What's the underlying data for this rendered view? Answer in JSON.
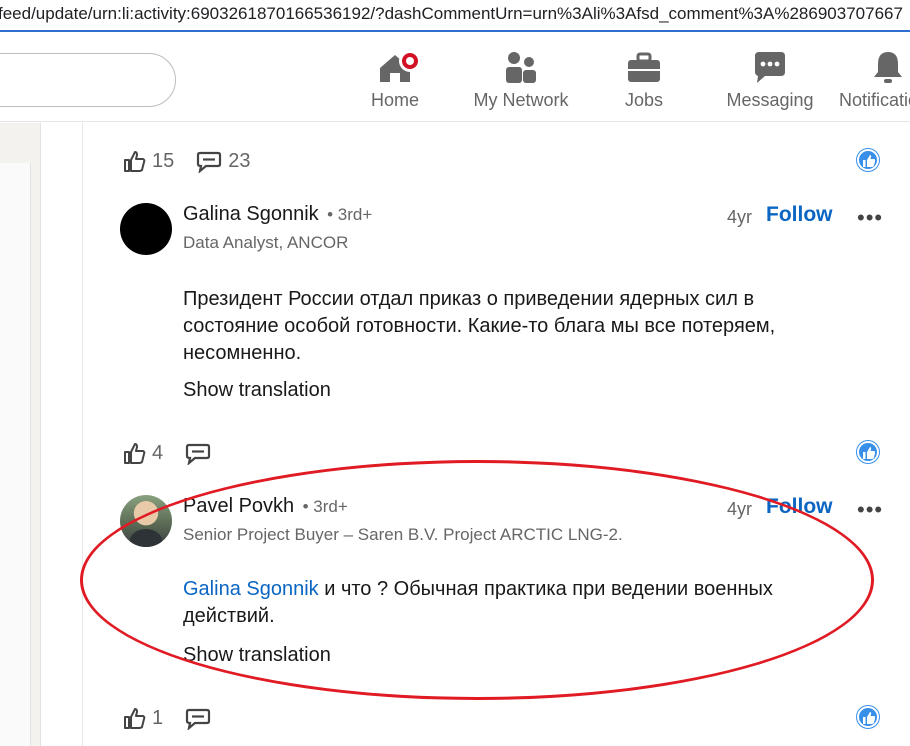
{
  "browser": {
    "url": "feed/update/urn:li:activity:6903261870166536192/?dashCommentUrn=urn%3Ali%3Afsd_comment%3A%286903707667"
  },
  "nav": {
    "items": [
      {
        "label": "Home",
        "icon": "home-icon"
      },
      {
        "label": "My Network",
        "icon": "network-icon"
      },
      {
        "label": "Jobs",
        "icon": "briefcase-icon"
      },
      {
        "label": "Messaging",
        "icon": "messaging-icon"
      },
      {
        "label": "Notifications",
        "icon": "bell-icon"
      }
    ]
  },
  "post_reactions": {
    "likes": "15",
    "comments": "23"
  },
  "comments": [
    {
      "author": "Galina Sgonnik",
      "degree": "• 3rd+",
      "headline": "Data Analyst, ANCOR",
      "time": "4yr",
      "follow": "Follow",
      "text": "Президент России отдал приказ о приведении ядерных сил в состояние особой готовности. Какие-то блага мы все потеряем, несомненно.",
      "show_translation": "Show translation",
      "likes": "4",
      "more": "•••"
    },
    {
      "author": "Pavel Povkh",
      "degree": "• 3rd+",
      "headline": "Senior Project Buyer – Saren B.V. Project ARCTIC LNG-2.",
      "time": "4yr",
      "follow": "Follow",
      "mention": "Galina Sgonnik",
      "text": " и что ? Обычная практика при ведении военных действий.",
      "show_translation": "Show translation",
      "likes": "1",
      "more": "•••"
    }
  ],
  "colors": {
    "accent": "#0a66c2",
    "annotation": "#e01b24",
    "like_blue": "#378fe9"
  }
}
